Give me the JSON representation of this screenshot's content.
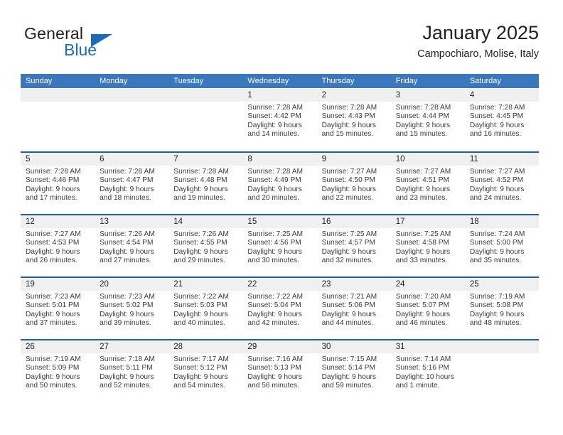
{
  "brand": {
    "name_part1": "General",
    "name_part2": "Blue",
    "logo_icon": "triangle-logo-icon",
    "accent_color": "#1b6cb5"
  },
  "header": {
    "title": "January 2025",
    "subtitle": "Campochiaro, Molise, Italy"
  },
  "theme": {
    "header_blue": "#3a77bd",
    "separator_blue": "#1f5fa8",
    "day_band_gray": "#f0f0f0",
    "text_color": "#231f20"
  },
  "calendar": {
    "weekday_headers": [
      "Sunday",
      "Monday",
      "Tuesday",
      "Wednesday",
      "Thursday",
      "Friday",
      "Saturday"
    ],
    "weeks": [
      [
        {
          "day": "",
          "sunrise": "",
          "sunset": "",
          "daylight_line1": "",
          "daylight_line2": "",
          "empty": true
        },
        {
          "day": "",
          "sunrise": "",
          "sunset": "",
          "daylight_line1": "",
          "daylight_line2": "",
          "empty": true
        },
        {
          "day": "",
          "sunrise": "",
          "sunset": "",
          "daylight_line1": "",
          "daylight_line2": "",
          "empty": true
        },
        {
          "day": "1",
          "sunrise": "Sunrise: 7:28 AM",
          "sunset": "Sunset: 4:42 PM",
          "daylight_line1": "Daylight: 9 hours",
          "daylight_line2": "and 14 minutes.",
          "empty": false
        },
        {
          "day": "2",
          "sunrise": "Sunrise: 7:28 AM",
          "sunset": "Sunset: 4:43 PM",
          "daylight_line1": "Daylight: 9 hours",
          "daylight_line2": "and 15 minutes.",
          "empty": false
        },
        {
          "day": "3",
          "sunrise": "Sunrise: 7:28 AM",
          "sunset": "Sunset: 4:44 PM",
          "daylight_line1": "Daylight: 9 hours",
          "daylight_line2": "and 15 minutes.",
          "empty": false
        },
        {
          "day": "4",
          "sunrise": "Sunrise: 7:28 AM",
          "sunset": "Sunset: 4:45 PM",
          "daylight_line1": "Daylight: 9 hours",
          "daylight_line2": "and 16 minutes.",
          "empty": false
        }
      ],
      [
        {
          "day": "5",
          "sunrise": "Sunrise: 7:28 AM",
          "sunset": "Sunset: 4:46 PM",
          "daylight_line1": "Daylight: 9 hours",
          "daylight_line2": "and 17 minutes.",
          "empty": false
        },
        {
          "day": "6",
          "sunrise": "Sunrise: 7:28 AM",
          "sunset": "Sunset: 4:47 PM",
          "daylight_line1": "Daylight: 9 hours",
          "daylight_line2": "and 18 minutes.",
          "empty": false
        },
        {
          "day": "7",
          "sunrise": "Sunrise: 7:28 AM",
          "sunset": "Sunset: 4:48 PM",
          "daylight_line1": "Daylight: 9 hours",
          "daylight_line2": "and 19 minutes.",
          "empty": false
        },
        {
          "day": "8",
          "sunrise": "Sunrise: 7:28 AM",
          "sunset": "Sunset: 4:49 PM",
          "daylight_line1": "Daylight: 9 hours",
          "daylight_line2": "and 20 minutes.",
          "empty": false
        },
        {
          "day": "9",
          "sunrise": "Sunrise: 7:27 AM",
          "sunset": "Sunset: 4:50 PM",
          "daylight_line1": "Daylight: 9 hours",
          "daylight_line2": "and 22 minutes.",
          "empty": false
        },
        {
          "day": "10",
          "sunrise": "Sunrise: 7:27 AM",
          "sunset": "Sunset: 4:51 PM",
          "daylight_line1": "Daylight: 9 hours",
          "daylight_line2": "and 23 minutes.",
          "empty": false
        },
        {
          "day": "11",
          "sunrise": "Sunrise: 7:27 AM",
          "sunset": "Sunset: 4:52 PM",
          "daylight_line1": "Daylight: 9 hours",
          "daylight_line2": "and 24 minutes.",
          "empty": false
        }
      ],
      [
        {
          "day": "12",
          "sunrise": "Sunrise: 7:27 AM",
          "sunset": "Sunset: 4:53 PM",
          "daylight_line1": "Daylight: 9 hours",
          "daylight_line2": "and 26 minutes.",
          "empty": false
        },
        {
          "day": "13",
          "sunrise": "Sunrise: 7:26 AM",
          "sunset": "Sunset: 4:54 PM",
          "daylight_line1": "Daylight: 9 hours",
          "daylight_line2": "and 27 minutes.",
          "empty": false
        },
        {
          "day": "14",
          "sunrise": "Sunrise: 7:26 AM",
          "sunset": "Sunset: 4:55 PM",
          "daylight_line1": "Daylight: 9 hours",
          "daylight_line2": "and 29 minutes.",
          "empty": false
        },
        {
          "day": "15",
          "sunrise": "Sunrise: 7:25 AM",
          "sunset": "Sunset: 4:56 PM",
          "daylight_line1": "Daylight: 9 hours",
          "daylight_line2": "and 30 minutes.",
          "empty": false
        },
        {
          "day": "16",
          "sunrise": "Sunrise: 7:25 AM",
          "sunset": "Sunset: 4:57 PM",
          "daylight_line1": "Daylight: 9 hours",
          "daylight_line2": "and 32 minutes.",
          "empty": false
        },
        {
          "day": "17",
          "sunrise": "Sunrise: 7:25 AM",
          "sunset": "Sunset: 4:58 PM",
          "daylight_line1": "Daylight: 9 hours",
          "daylight_line2": "and 33 minutes.",
          "empty": false
        },
        {
          "day": "18",
          "sunrise": "Sunrise: 7:24 AM",
          "sunset": "Sunset: 5:00 PM",
          "daylight_line1": "Daylight: 9 hours",
          "daylight_line2": "and 35 minutes.",
          "empty": false
        }
      ],
      [
        {
          "day": "19",
          "sunrise": "Sunrise: 7:23 AM",
          "sunset": "Sunset: 5:01 PM",
          "daylight_line1": "Daylight: 9 hours",
          "daylight_line2": "and 37 minutes.",
          "empty": false
        },
        {
          "day": "20",
          "sunrise": "Sunrise: 7:23 AM",
          "sunset": "Sunset: 5:02 PM",
          "daylight_line1": "Daylight: 9 hours",
          "daylight_line2": "and 39 minutes.",
          "empty": false
        },
        {
          "day": "21",
          "sunrise": "Sunrise: 7:22 AM",
          "sunset": "Sunset: 5:03 PM",
          "daylight_line1": "Daylight: 9 hours",
          "daylight_line2": "and 40 minutes.",
          "empty": false
        },
        {
          "day": "22",
          "sunrise": "Sunrise: 7:22 AM",
          "sunset": "Sunset: 5:04 PM",
          "daylight_line1": "Daylight: 9 hours",
          "daylight_line2": "and 42 minutes.",
          "empty": false
        },
        {
          "day": "23",
          "sunrise": "Sunrise: 7:21 AM",
          "sunset": "Sunset: 5:06 PM",
          "daylight_line1": "Daylight: 9 hours",
          "daylight_line2": "and 44 minutes.",
          "empty": false
        },
        {
          "day": "24",
          "sunrise": "Sunrise: 7:20 AM",
          "sunset": "Sunset: 5:07 PM",
          "daylight_line1": "Daylight: 9 hours",
          "daylight_line2": "and 46 minutes.",
          "empty": false
        },
        {
          "day": "25",
          "sunrise": "Sunrise: 7:19 AM",
          "sunset": "Sunset: 5:08 PM",
          "daylight_line1": "Daylight: 9 hours",
          "daylight_line2": "and 48 minutes.",
          "empty": false
        }
      ],
      [
        {
          "day": "26",
          "sunrise": "Sunrise: 7:19 AM",
          "sunset": "Sunset: 5:09 PM",
          "daylight_line1": "Daylight: 9 hours",
          "daylight_line2": "and 50 minutes.",
          "empty": false
        },
        {
          "day": "27",
          "sunrise": "Sunrise: 7:18 AM",
          "sunset": "Sunset: 5:11 PM",
          "daylight_line1": "Daylight: 9 hours",
          "daylight_line2": "and 52 minutes.",
          "empty": false
        },
        {
          "day": "28",
          "sunrise": "Sunrise: 7:17 AM",
          "sunset": "Sunset: 5:12 PM",
          "daylight_line1": "Daylight: 9 hours",
          "daylight_line2": "and 54 minutes.",
          "empty": false
        },
        {
          "day": "29",
          "sunrise": "Sunrise: 7:16 AM",
          "sunset": "Sunset: 5:13 PM",
          "daylight_line1": "Daylight: 9 hours",
          "daylight_line2": "and 56 minutes.",
          "empty": false
        },
        {
          "day": "30",
          "sunrise": "Sunrise: 7:15 AM",
          "sunset": "Sunset: 5:14 PM",
          "daylight_line1": "Daylight: 9 hours",
          "daylight_line2": "and 59 minutes.",
          "empty": false
        },
        {
          "day": "31",
          "sunrise": "Sunrise: 7:14 AM",
          "sunset": "Sunset: 5:16 PM",
          "daylight_line1": "Daylight: 10 hours",
          "daylight_line2": "and 1 minute.",
          "empty": false
        },
        {
          "day": "",
          "sunrise": "",
          "sunset": "",
          "daylight_line1": "",
          "daylight_line2": "",
          "empty": true
        }
      ]
    ]
  }
}
